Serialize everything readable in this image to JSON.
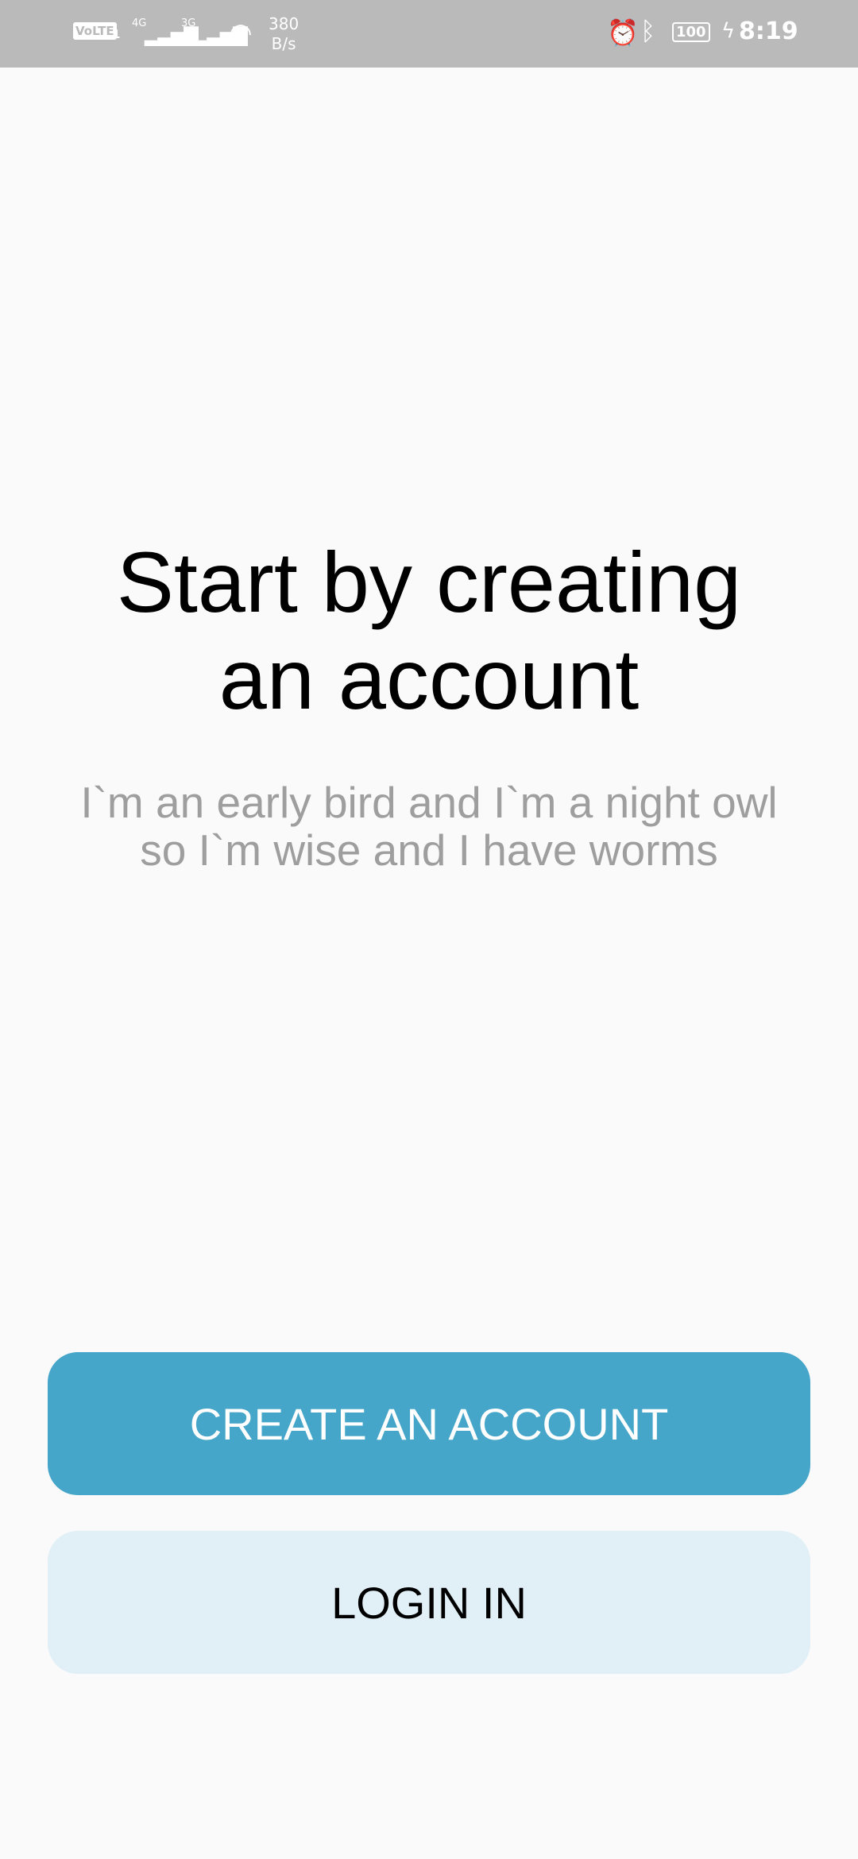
{
  "status_bar": {
    "volte": "VoLTE",
    "sim": "1",
    "network1": "4G",
    "network2": "3G",
    "speed_value": "380",
    "speed_unit": "B/s",
    "battery": "100",
    "time": "8:19",
    "icons": [
      "signal-icon",
      "wifi-icon",
      "alarm-icon",
      "bluetooth-icon",
      "battery-icon",
      "charging-icon"
    ]
  },
  "main": {
    "title": "Start by creating an account",
    "subtitle_line1": "I`m an early bird and I`m a night owl",
    "subtitle_line2": "so I`m wise and I have worms"
  },
  "buttons": {
    "create": "CREATE AN ACCOUNT",
    "login": "LOGIN IN"
  },
  "colors": {
    "primary": "#45a6c9",
    "secondary": "#e1eff6",
    "status_bar": "#bababa"
  }
}
